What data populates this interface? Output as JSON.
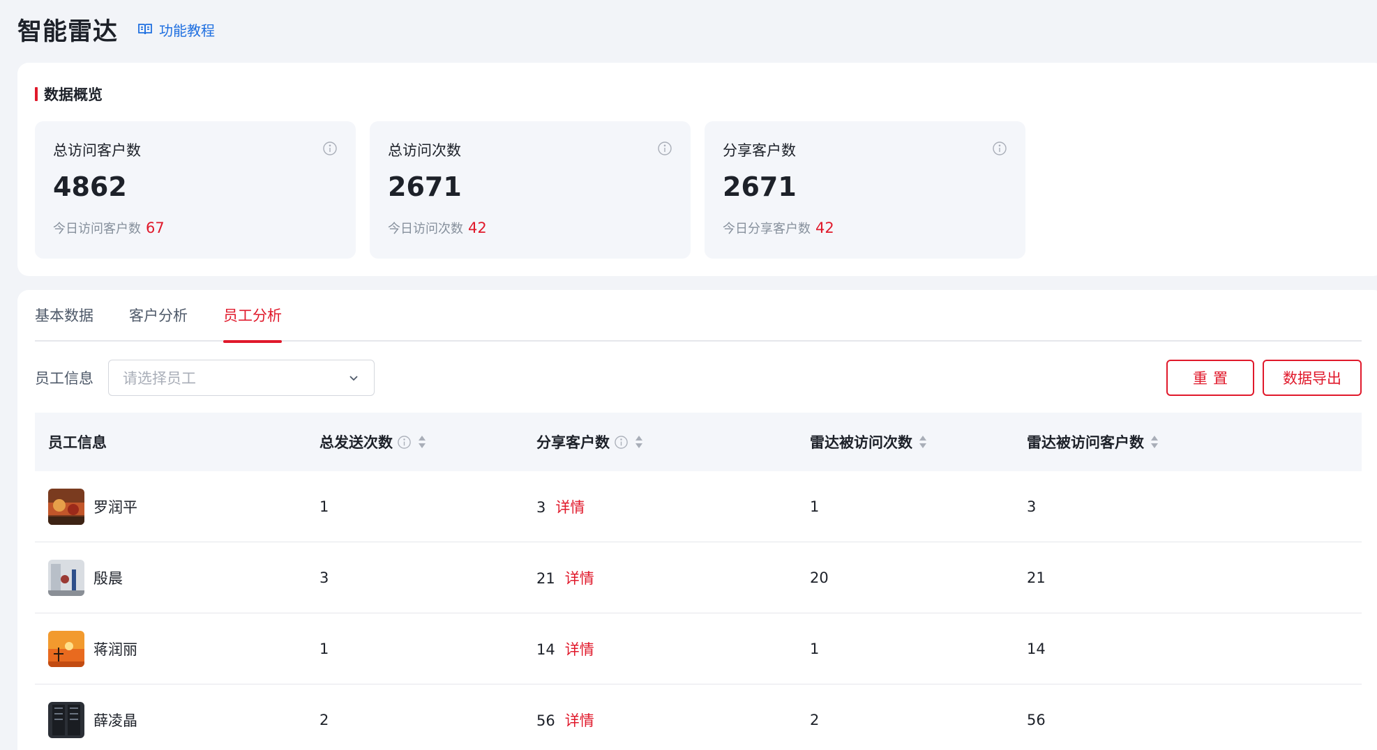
{
  "header": {
    "title": "智能雷达",
    "tutorial_label": "功能教程",
    "tutorial_icon": "book-icon"
  },
  "overview": {
    "section_title": "数据概览",
    "cards": [
      {
        "label": "总访问客户数",
        "value": "4862",
        "sub_label": "今日访问客户数",
        "sub_value": "67"
      },
      {
        "label": "总访问次数",
        "value": "2671",
        "sub_label": "今日访问次数",
        "sub_value": "42"
      },
      {
        "label": "分享客户数",
        "value": "2671",
        "sub_label": "今日分享客户数",
        "sub_value": "42"
      }
    ]
  },
  "tabs": [
    {
      "label": "基本数据",
      "active": false
    },
    {
      "label": "客户分析",
      "active": false
    },
    {
      "label": "员工分析",
      "active": true
    }
  ],
  "filter": {
    "label": "员工信息",
    "placeholder": "请选择员工",
    "reset_label": "重置",
    "export_label": "数据导出"
  },
  "table": {
    "columns": [
      "员工信息",
      "总发送次数",
      "分享客户数",
      "雷达被访问次数",
      "雷达被访问客户数"
    ],
    "detail_label": "详情",
    "rows": [
      {
        "name": "罗润平",
        "total_sends": "1",
        "shared_customers": "3",
        "radar_visits": "1",
        "radar_visitors": "3"
      },
      {
        "name": "殷晨",
        "total_sends": "3",
        "shared_customers": "21",
        "radar_visits": "20",
        "radar_visitors": "21"
      },
      {
        "name": "蒋润丽",
        "total_sends": "1",
        "shared_customers": "14",
        "radar_visits": "1",
        "radar_visitors": "14"
      },
      {
        "name": "薛凌晶",
        "total_sends": "2",
        "shared_customers": "56",
        "radar_visits": "2",
        "radar_visitors": "56"
      }
    ]
  },
  "colors": {
    "accent": "#e0192b",
    "link": "#1f6fe0",
    "card_bg": "#f4f6fa",
    "page_bg": "#f2f4f8"
  }
}
